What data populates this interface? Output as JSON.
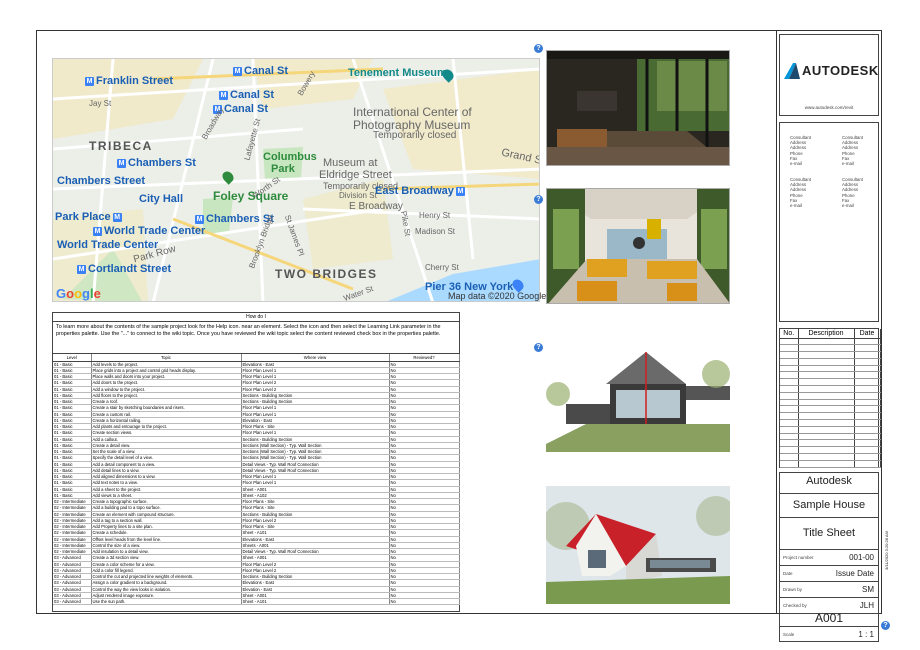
{
  "map": {
    "places": {
      "franklin": "Franklin Street",
      "canal_st_1": "Canal St",
      "tenement": "Tenement Museum",
      "canal_st_2": "Canal St",
      "canal_st_3": "Canal St",
      "icp_1": "International Center of",
      "icp_2": "Photography Museum",
      "icp_closed": "Temporarily closed",
      "tribeca": "TRIBECA",
      "chambers_1": "Chambers St",
      "columbus_1": "Columbus",
      "columbus_2": "Park",
      "eldridge_1": "Museum at",
      "eldridge_2": "Eldridge Street",
      "eldridge_closed": "Temporarily closed",
      "grand": "Grand St",
      "chambers_street": "Chambers Street",
      "foley": "Foley Square",
      "city_hall": "City Hall",
      "east_broadway_m": "East Broadway",
      "e_broadway": "E Broadway",
      "park_place": "Park Place",
      "chambers_2": "Chambers St",
      "wtc_1": "World Trade Center",
      "wtc_2": "World Trade Center",
      "park_row": "Park Row",
      "cortlandt": "Cortlandt Street",
      "two_bridges": "TWO BRIDGES",
      "pier36": "Pier 36 New York",
      "broadway": "Broadway",
      "lafayette": "Lafayette St",
      "worth": "Worth St",
      "division": "Division St",
      "henry": "Henry St",
      "madison": "Madison St",
      "pike": "Pike St",
      "jay": "Jay St",
      "water": "Water St",
      "cherry": "Cherry St",
      "bridge": "Brooklyn Bridge",
      "st_james": "St James Pl",
      "bowery": "Bowery"
    },
    "google": "Google",
    "attribution": "Map data ©2020 Google"
  },
  "howto": {
    "title": "How do I",
    "description": "To learn more about the contents of the sample project look for the Help icon. near an element. Select the icon and then select the Learning Link parameter in the properties palette. Use the \"...\" to connect to the wiki topic. Once you have reviewed the wiki topic select the content reviewed check box in the properties palette.",
    "headers": [
      "Level",
      "Topic",
      "Where view",
      "Reviewed?"
    ],
    "rows": [
      [
        "01 - Basic",
        "Add levels to the project.",
        "Elevations - East",
        "No"
      ],
      [
        "01 - Basic",
        "Place grids into a project and control grid heads display.",
        "Floor Plan Level 1",
        "No"
      ],
      [
        "01 - Basic",
        "Place walls and doors into your project.",
        "Floor Plan Level 1",
        "No"
      ],
      [
        "01 - Basic",
        "Add doors to the project.",
        "Floor Plan Level 2",
        "No"
      ],
      [
        "01 - Basic",
        "Add a window to the project.",
        "Floor Plan Level 2",
        "No"
      ],
      [
        "01 - Basic",
        "Add floors to the project.",
        "Sections - Building Section",
        "No"
      ],
      [
        "01 - Basic",
        "Create a roof.",
        "Sections - Building Section",
        "No"
      ],
      [
        "01 - Basic",
        "Create a stair by sketching boundaries and risers.",
        "Floor Plan Level 1",
        "No"
      ],
      [
        "01 - Basic",
        "Create a custom rail.",
        "Floor Plan Level 1",
        "No"
      ],
      [
        "01 - Basic",
        "Create a horizontal railing.",
        "Elevation - East",
        "No"
      ],
      [
        "01 - Basic",
        "Add plants and entourage to the project.",
        "Floor Plans - Site",
        "No"
      ],
      [
        "01 - Basic",
        "Create section views.",
        "Floor Plan Level 1",
        "No"
      ],
      [
        "01 - Basic",
        "Add a callout.",
        "Sections - Building Section",
        "No"
      ],
      [
        "01 - Basic",
        "Create a detail view.",
        "Sections (Wall Section) - Typ. Wall Section",
        "No"
      ],
      [
        "01 - Basic",
        "Set the scale of a view.",
        "Sections (Wall Section) - Typ. Wall Section",
        "No"
      ],
      [
        "01 - Basic",
        "Specify the detail level of a view.",
        "Sections (Wall Section) - Typ. Wall Section",
        "No"
      ],
      [
        "01 - Basic",
        "Add a detail component to a view.",
        "Detail Views - Typ. Wall Roof Connection",
        "No"
      ],
      [
        "01 - Basic",
        "Add detail lines to a view.",
        "Detail Views - Typ. Wall Roof Connection",
        "No"
      ],
      [
        "01 - Basic",
        "Add aligned dimensions to a view.",
        "Floor Plan Level 1",
        "No"
      ],
      [
        "01 - Basic",
        "Add text notes to a view.",
        "Floor Plan Level 1",
        "No"
      ],
      [
        "01 - Basic",
        "Add a sheet to the project.",
        "Sheet - A001",
        "No"
      ],
      [
        "01 - Basic",
        "Add views to a sheet.",
        "Sheet - A102",
        "No"
      ],
      [
        "02 - Intermediate",
        "Create a topographic surface.",
        "Floor Plans - Site",
        "No"
      ],
      [
        "02 - Intermediate",
        "Add a building pad to a topo surface.",
        "Floor Plans - Site",
        "No"
      ],
      [
        "02 - Intermediate",
        "Create an element with compound structure.",
        "Sections - Building Section",
        "No"
      ],
      [
        "02 - Intermediate",
        "Add a tag to a section wall.",
        "Floor Plan Level 2",
        "No"
      ],
      [
        "02 - Intermediate",
        "Add Property lines to a site plan.",
        "Floor Plans - Site",
        "No"
      ],
      [
        "02 - Intermediate",
        "Create a schedule.",
        "Sheet - A101",
        "No"
      ],
      [
        "02 - Intermediate",
        "Offset level heads from the level line.",
        "Elevations - East",
        "No"
      ],
      [
        "02 - Intermediate",
        "Control the size of a view.",
        "Sheets - A001",
        "No"
      ],
      [
        "02 - Intermediate",
        "Add insulation to a detail view.",
        "Detail Views - Typ. Wall Roof Connection",
        "No"
      ],
      [
        "03 - Advanced",
        "Create a 3d section view.",
        "Sheet - A001",
        "No"
      ],
      [
        "03 - Advanced",
        "Create a color scheme for a view.",
        "Floor Plan Level 2",
        "No"
      ],
      [
        "03 - Advanced",
        "Add a color fill legend.",
        "Floor Plan Level 2",
        "No"
      ],
      [
        "03 - Advanced",
        "Control the cut and projected line weights of elements.",
        "Sections - Building Section",
        "No"
      ],
      [
        "03 - Advanced",
        "Assign a color gradient to a background.",
        "Elevations - East",
        "No"
      ],
      [
        "03 - Advanced",
        "Control the way the view looks in isolation.",
        "Elevation - East",
        "No"
      ],
      [
        "03 - Advanced",
        "Adjust rendered image exposure.",
        "Sheet - A001",
        "No"
      ],
      [
        "03 - Advanced",
        "Use the sun path.",
        "Sheet - A101",
        "No"
      ]
    ]
  },
  "help_icon": "?",
  "titleblock": {
    "brand": "AUTODESK",
    "url": "www.autodesk.com/revit",
    "consultant": [
      "Consultant",
      "Address",
      "Address",
      "Phone",
      "Fax",
      "e-mail"
    ],
    "revision_headers": [
      "No.",
      "Description",
      "Date"
    ],
    "company": "Autodesk",
    "project": "Sample House",
    "sheet_title": "Title Sheet",
    "fields": [
      {
        "key": "Project number",
        "value": "001-00"
      },
      {
        "key": "Date",
        "value": "Issue Date"
      },
      {
        "key": "Drawn by",
        "value": "SM"
      },
      {
        "key": "Checked by",
        "value": "JLH"
      }
    ],
    "sheet_number": "A001",
    "scale_label": "Scale",
    "scale_value": "1 : 1",
    "timestamp": "3/11/2020 3:20:28 AM"
  },
  "colors": {
    "map_water": "#aadaff",
    "map_park": "#c8e6c0",
    "map_block": "#f7e9b3",
    "roof_red": "#c8212a",
    "help_blue": "#3a7bd5"
  }
}
